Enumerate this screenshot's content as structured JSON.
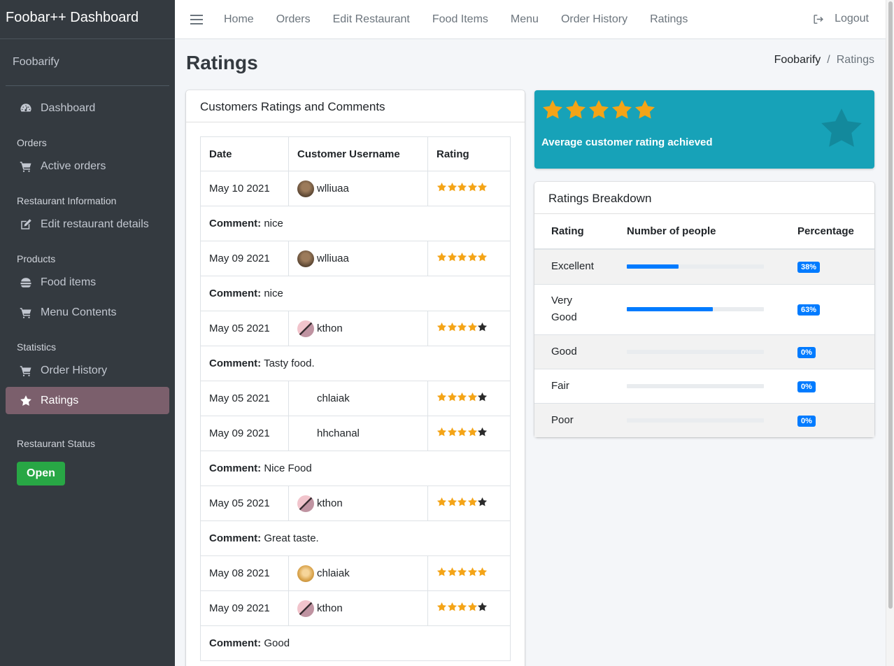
{
  "app": {
    "brand": "Foobar++ Dashboard",
    "user": "Foobarify"
  },
  "sidebar": {
    "dashboard": "Dashboard",
    "groups": {
      "orders": "Orders",
      "restaurant": "Restaurant Information",
      "products": "Products",
      "statistics": "Statistics",
      "status": "Restaurant Status"
    },
    "items": {
      "active_orders": "Active orders",
      "edit_restaurant": "Edit restaurant details",
      "food_items": "Food items",
      "menu_contents": "Menu Contents",
      "order_history": "Order History",
      "ratings": "Ratings"
    },
    "status_button": "Open",
    "active_color": "#7b5f6c"
  },
  "topnav": {
    "links": [
      "Home",
      "Orders",
      "Edit Restaurant",
      "Food Items",
      "Menu",
      "Order History",
      "Ratings"
    ],
    "logout": "Logout"
  },
  "page": {
    "title": "Ratings",
    "breadcrumb": [
      "Foobarify",
      "/",
      "Ratings"
    ]
  },
  "ratings_table": {
    "header": "Customers Ratings and Comments",
    "columns": [
      "Date",
      "Customer Username",
      "Rating"
    ],
    "comment_label": "Comment:",
    "rows": [
      {
        "type": "rating",
        "date": "May 10 2021",
        "user": "wlliuaa",
        "avatar": "a1",
        "stars": 5
      },
      {
        "type": "comment",
        "text": "nice"
      },
      {
        "type": "rating",
        "date": "May 09 2021",
        "user": "wlliuaa",
        "avatar": "a1",
        "stars": 5
      },
      {
        "type": "comment",
        "text": "nice"
      },
      {
        "type": "rating",
        "date": "May 05 2021",
        "user": "kthon",
        "avatar": "a2",
        "stars": 4
      },
      {
        "type": "comment",
        "text": "Tasty food."
      },
      {
        "type": "rating",
        "date": "May 05 2021",
        "user": "chlaiak",
        "avatar": "none",
        "stars": 4
      },
      {
        "type": "rating",
        "date": "May 09 2021",
        "user": "hhchanal",
        "avatar": "none",
        "stars": 4
      },
      {
        "type": "comment",
        "text": "Nice Food"
      },
      {
        "type": "rating",
        "date": "May 05 2021",
        "user": "kthon",
        "avatar": "a2",
        "stars": 4
      },
      {
        "type": "comment",
        "text": "Great taste."
      },
      {
        "type": "rating",
        "date": "May 08 2021",
        "user": "chlaiak",
        "avatar": "a3",
        "stars": 5
      },
      {
        "type": "rating",
        "date": "May 09 2021",
        "user": "kthon",
        "avatar": "a2",
        "stars": 4
      },
      {
        "type": "comment",
        "text": "Good"
      }
    ]
  },
  "average": {
    "stars": 5,
    "label": "Average customer rating achieved",
    "color": "#17a2b8"
  },
  "breakdown": {
    "header": "Ratings Breakdown",
    "columns": [
      "Rating",
      "Number of people",
      "Percentage"
    ],
    "rows": [
      {
        "label": "Excellent",
        "fraction": 0.38,
        "pct": "38%"
      },
      {
        "label": "Very Good",
        "fraction": 0.63,
        "pct": "63%"
      },
      {
        "label": "Good",
        "fraction": 0,
        "pct": "0%"
      },
      {
        "label": "Fair",
        "fraction": 0,
        "pct": "0%"
      },
      {
        "label": "Poor",
        "fraction": 0,
        "pct": "0%"
      }
    ]
  },
  "colors": {
    "star": "#f4a417",
    "accent": "#007bff",
    "success": "#28a745"
  }
}
